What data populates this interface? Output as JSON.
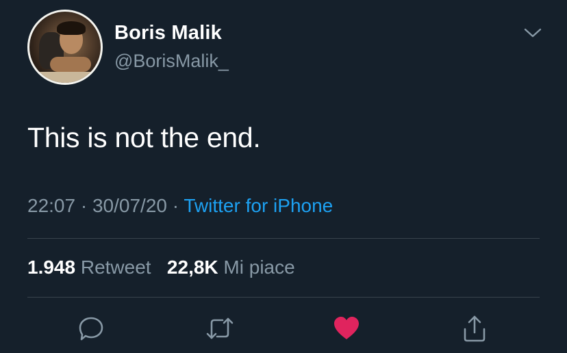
{
  "author": {
    "name": "Boris Malik",
    "handle": "@BorisMalik_"
  },
  "tweet": {
    "text": "This is not the end.",
    "time": "22:07",
    "separator": "·",
    "date": "30/07/20",
    "source": "Twitter for iPhone"
  },
  "stats": {
    "retweets_count": "1.948",
    "retweets_label": "Retweet",
    "likes_count": "22,8K",
    "likes_label": "Mi piace"
  },
  "colors": {
    "background": "#15202b",
    "secondary_text": "#8899a6",
    "link": "#1da1f2",
    "like_active": "#e0245e",
    "divider": "#38444d"
  },
  "icons": {
    "menu": "chevron-down-icon",
    "reply": "reply-icon",
    "retweet": "retweet-icon",
    "like": "heart-icon",
    "share": "share-icon"
  },
  "state": {
    "liked": true
  }
}
